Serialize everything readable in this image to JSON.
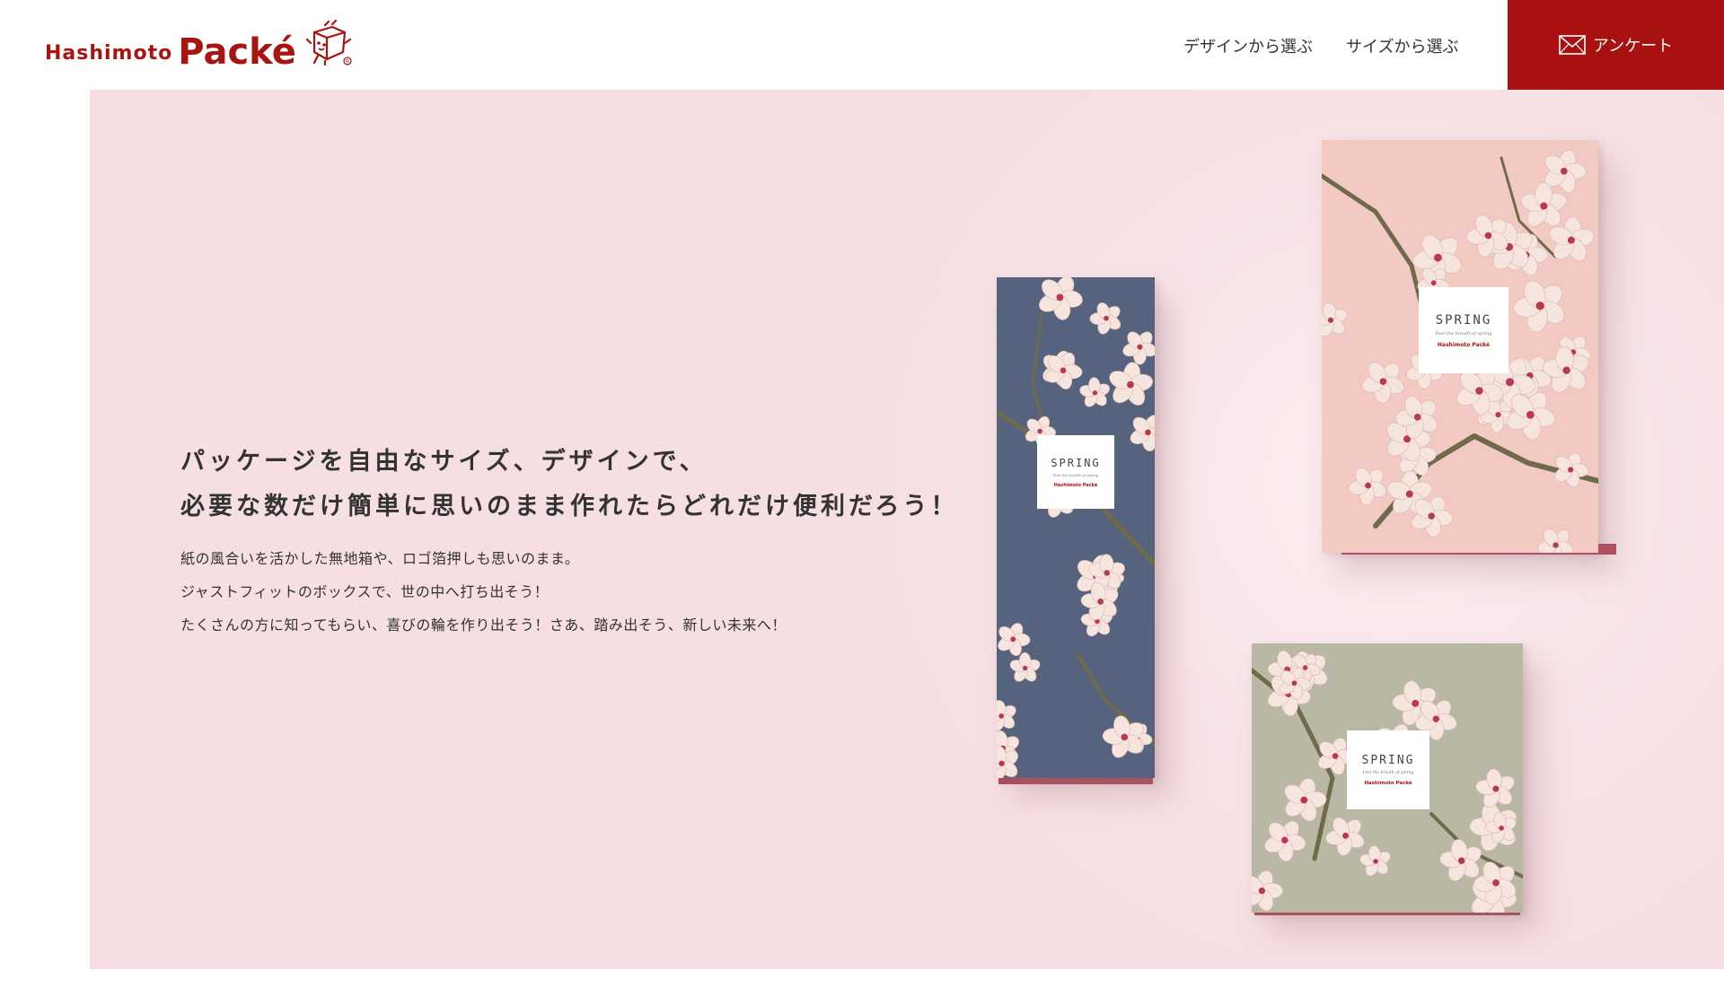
{
  "header": {
    "logo_small": "Hashimoto",
    "logo_big": "Packé",
    "nav": {
      "design_label": "デザインから選ぶ",
      "size_label": "サイズから選ぶ"
    },
    "survey_label": "アンケート"
  },
  "hero": {
    "headline_line1": "パッケージを自由なサイズ、デザインで、",
    "headline_line2": "必要な数だけ簡単に思いのまま作れたらどれだけ便利だろう！",
    "body_line1": "紙の風合いを活かした無地箱や、ロゴ箔押しも思いのまま。",
    "body_line2": "ジャストフィットのボックスで、世の中へ打ち出そう！",
    "body_line3": "たくさんの方に知ってもらい、喜びの輪を作り出そう！さあ、踏み出そう、新しい未来へ！"
  },
  "boxes": {
    "label_title": "SPRING",
    "label_script": "Feel the breath of spring",
    "label_brand": "Hashimoto Packé"
  },
  "colors": {
    "brand": "#a8110f",
    "hero_bg": "#f6dfe3",
    "box_navy": "#56637f",
    "box_pink": "#f3c9c3",
    "box_sage": "#b8b8a5",
    "blossom": "#f6e4de",
    "blossom_center": "#b83a4e",
    "branch": "#6f6b4a"
  }
}
